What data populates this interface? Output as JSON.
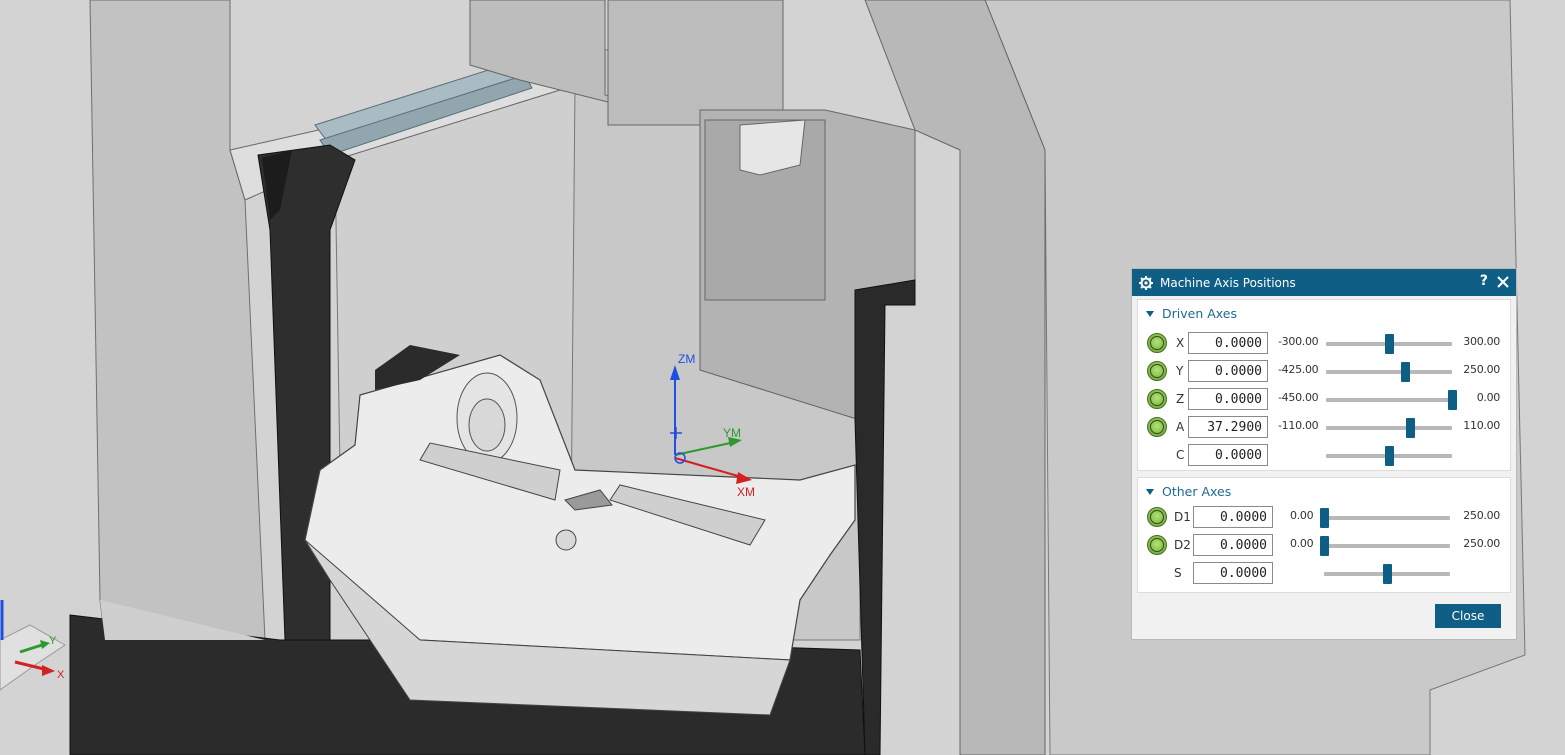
{
  "viewport": {
    "csys_labels": {
      "zm": "ZM",
      "ym": "YM",
      "xm": "XM"
    },
    "triad_labels": {
      "y": "Y",
      "x": "X"
    }
  },
  "dialog": {
    "title": "Machine Axis Positions",
    "help_label": "?",
    "driven_axes": {
      "label": "Driven Axes",
      "rows": [
        {
          "name": "X",
          "value": "0.0000",
          "min": "-300.00",
          "max": "300.00",
          "position": 0.5,
          "has_led": true
        },
        {
          "name": "Y",
          "value": "0.0000",
          "min": "-425.00",
          "max": "250.00",
          "position": 0.63,
          "has_led": true
        },
        {
          "name": "Z",
          "value": "0.0000",
          "min": "-450.00",
          "max": "0.00",
          "position": 1.0,
          "has_led": true
        },
        {
          "name": "A",
          "value": "37.2900",
          "min": "-110.00",
          "max": "110.00",
          "position": 0.67,
          "has_led": true
        },
        {
          "name": "C",
          "value": "0.0000",
          "min": "",
          "max": "",
          "position": 0.5,
          "has_led": false
        }
      ]
    },
    "other_axes": {
      "label": "Other Axes",
      "rows": [
        {
          "name": "D1",
          "value": "0.0000",
          "min": "0.00",
          "max": "250.00",
          "position": 0.0,
          "has_led": true
        },
        {
          "name": "D2",
          "value": "0.0000",
          "min": "0.00",
          "max": "250.00",
          "position": 0.0,
          "has_led": true
        },
        {
          "name": "S",
          "value": "0.0000",
          "min": "",
          "max": "",
          "position": 0.5,
          "has_led": false
        }
      ]
    },
    "close_label": "Close"
  },
  "colors": {
    "accent": "#0e5e86",
    "led_green": "#86c04a",
    "axis_z": "#1f4fe0",
    "axis_y": "#2e9a2e",
    "axis_x": "#d42020"
  }
}
